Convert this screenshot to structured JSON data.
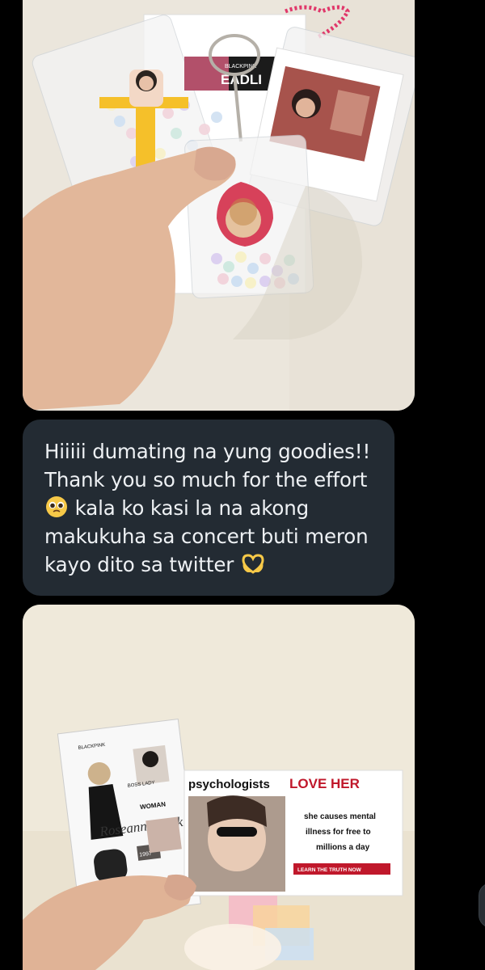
{
  "message": {
    "lines": [
      "Hiiiii dumating na yung goodies!!",
      "Thank you so much for the effort",
      "kala ko kasi la na akong",
      "makukuha sa concert buti meron",
      "kayo dito sa twitter"
    ],
    "emoji_1": "pleading-face-emoji",
    "emoji_2": "heart-hands-emoji"
  },
  "photo1": {
    "description_icons": "photo-of-keychain-goodies",
    "keychain_text_1": "BLACKPINK",
    "keychain_text_2": "EADLI"
  },
  "photo2": {
    "sticker_sheet": {
      "label_1": "BLACKPINK",
      "label_2": "WOMAN",
      "label_3": "Roseanne Park",
      "label_4": "BOSS LADY",
      "label_5": "1997"
    },
    "card": {
      "headline_prefix": "psychologists",
      "headline_emphasis": "LOVE HER",
      "body": [
        "she causes mental",
        "illness for free to",
        "millions a day"
      ],
      "cta": "LEARN THE TRUTH NOW"
    }
  },
  "colors": {
    "background": "#000000",
    "bubble": "#232b33",
    "bubble_text": "#eef1f4",
    "card_red": "#c0182b"
  }
}
